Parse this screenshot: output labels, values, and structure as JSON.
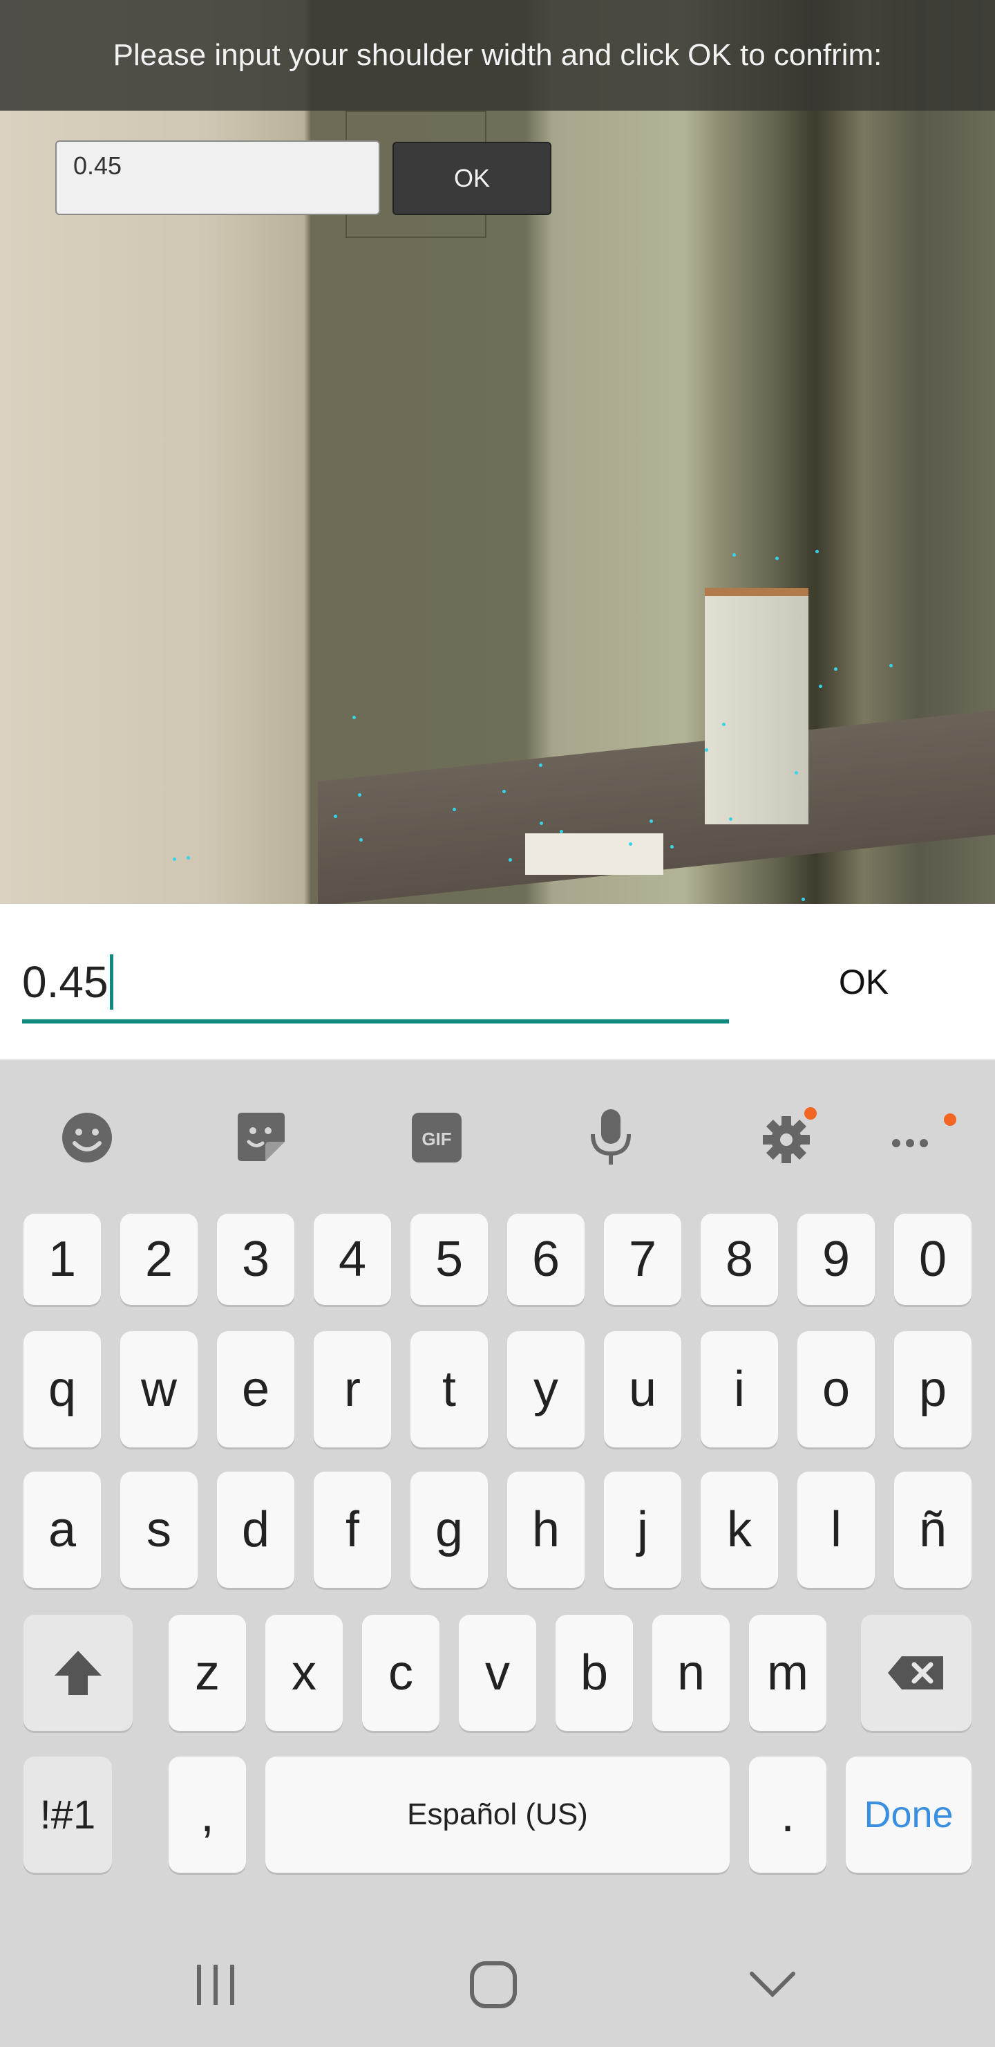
{
  "prompt": {
    "text": "Please input your shoulder width and click OK to confrim:"
  },
  "overlay": {
    "input_value": "0.45",
    "ok_label": "OK"
  },
  "entry": {
    "value": "0.45",
    "ok_label": "OK"
  },
  "toolbar": {
    "icons": [
      "emoji-icon",
      "sticker-icon",
      "gif-icon",
      "microphone-icon",
      "settings-icon",
      "more-icon"
    ],
    "gif_label": "GIF"
  },
  "keyboard": {
    "row1": [
      "1",
      "2",
      "3",
      "4",
      "5",
      "6",
      "7",
      "8",
      "9",
      "0"
    ],
    "row2": [
      "q",
      "w",
      "e",
      "r",
      "t",
      "y",
      "u",
      "i",
      "o",
      "p"
    ],
    "row3": [
      "a",
      "s",
      "d",
      "f",
      "g",
      "h",
      "j",
      "k",
      "l",
      "ñ"
    ],
    "row4": [
      "z",
      "x",
      "c",
      "v",
      "b",
      "n",
      "m"
    ],
    "symbols_label": "!#1",
    "comma_label": ",",
    "space_label": "Español (US)",
    "period_label": ".",
    "done_label": "Done"
  },
  "colors": {
    "accent": "#0f8a7e",
    "done": "#3a8fe0",
    "notify_dot": "#f26522"
  },
  "navbar": {
    "icons": [
      "recent-apps-icon",
      "home-icon",
      "back-chevron-icon"
    ]
  }
}
